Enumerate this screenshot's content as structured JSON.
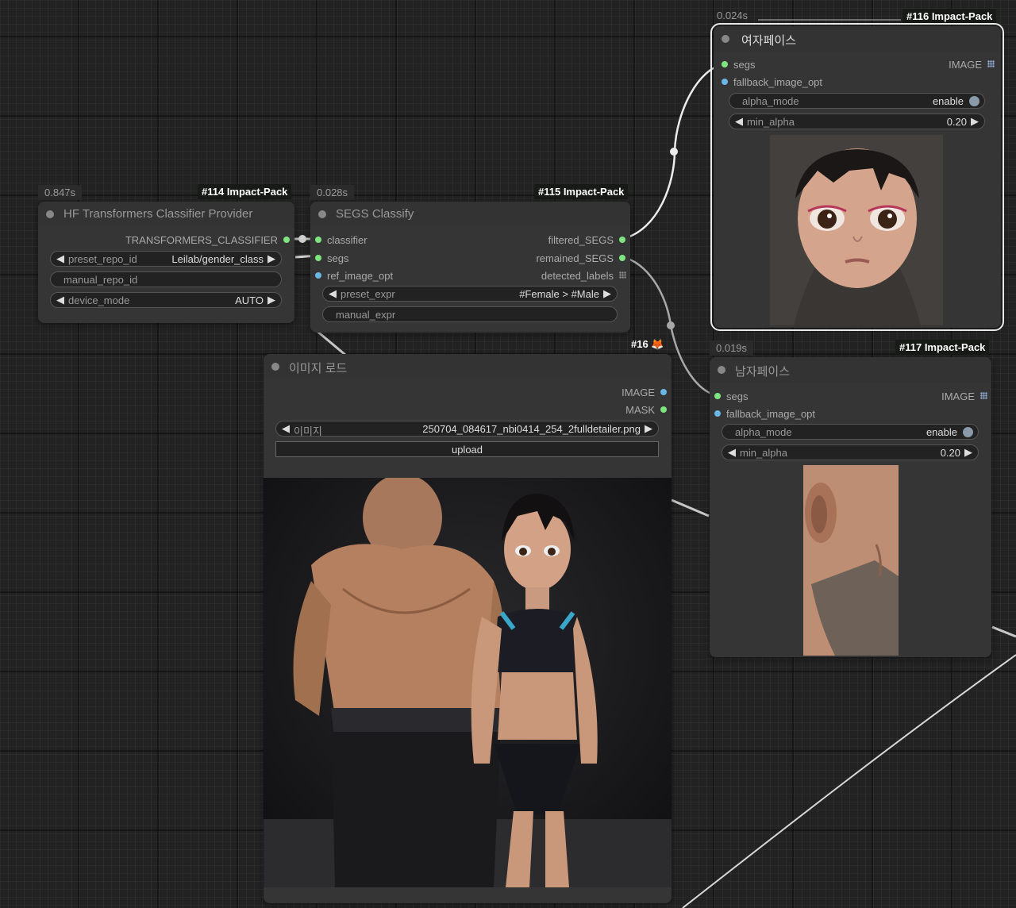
{
  "nodes": {
    "hf": {
      "timing": "0.847s",
      "badge": "#114 Impact-Pack",
      "title": "HF Transformers Classifier Provider",
      "output": "TRANSFORMERS_CLASSIFIER",
      "preset_repo_id": {
        "label": "preset_repo_id",
        "value": "Leilab/gender_class"
      },
      "manual_repo_id": {
        "label": "manual_repo_id"
      },
      "device_mode": {
        "label": "device_mode",
        "value": "AUTO"
      }
    },
    "segs_classify": {
      "timing": "0.028s",
      "badge": "#115 Impact-Pack",
      "title": "SEGS Classify",
      "inputs": [
        "classifier",
        "segs",
        "ref_image_opt"
      ],
      "outputs": [
        "filtered_SEGS",
        "remained_SEGS",
        "detected_labels"
      ],
      "preset_expr": {
        "label": "preset_expr",
        "value": "#Female > #Male"
      },
      "manual_expr": {
        "label": "manual_expr"
      }
    },
    "female_face": {
      "timing": "0.024s",
      "badge": "#116 Impact-Pack",
      "title": "여자페이스",
      "inputs": [
        "segs",
        "fallback_image_opt"
      ],
      "output": "IMAGE",
      "alpha_mode": {
        "label": "alpha_mode",
        "value": "enable"
      },
      "min_alpha": {
        "label": "min_alpha",
        "value": "0.20"
      }
    },
    "male_face": {
      "timing": "0.019s",
      "badge": "#117 Impact-Pack",
      "title": "남자페이스",
      "inputs": [
        "segs",
        "fallback_image_opt"
      ],
      "output": "IMAGE",
      "alpha_mode": {
        "label": "alpha_mode",
        "value": "enable"
      },
      "min_alpha": {
        "label": "min_alpha",
        "value": "0.20"
      }
    },
    "load_image": {
      "badge": "#16 🦊",
      "title": "이미지 로드",
      "outputs": [
        "IMAGE",
        "MASK"
      ],
      "image": {
        "label": "이미지",
        "value": "250704_084617_nbi0414_254_2fulldetailer.png"
      },
      "upload_label": "upload"
    }
  },
  "colors": {
    "canvas": "#222222",
    "node_bg": "#353535",
    "link": "#e8e8e8",
    "pin_green": "#7fe67f",
    "pin_blue": "#6ab7e6"
  },
  "icons": [
    "arrow-left-icon",
    "arrow-right-icon",
    "toggle-knob-icon",
    "grid-list-icon",
    "fox-icon"
  ]
}
